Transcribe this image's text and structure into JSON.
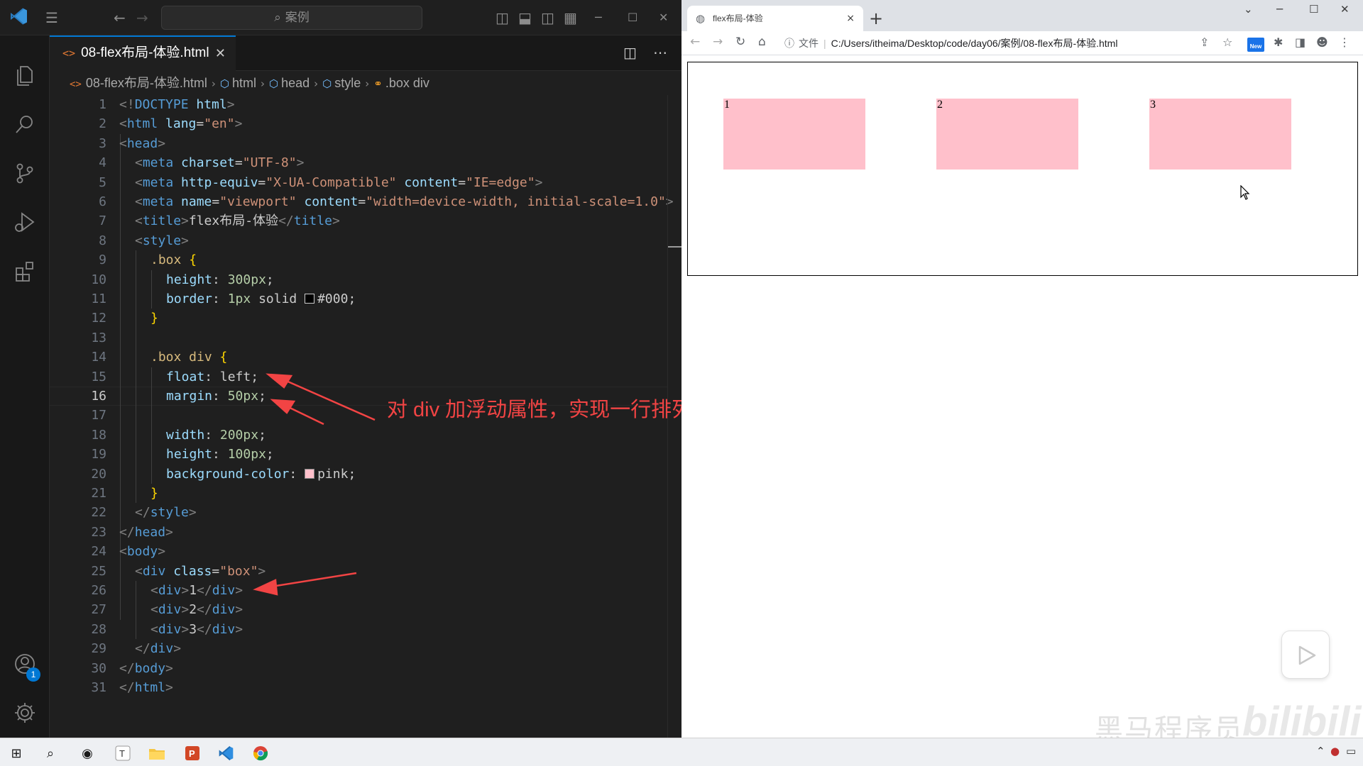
{
  "vscode": {
    "search_placeholder": "案例",
    "tab": {
      "label": "08-flex布局-体验.html",
      "close": "✕"
    },
    "breadcrumb": {
      "file": "08-flex布局-体验.html",
      "items": [
        "html",
        "head",
        "style",
        ".box div"
      ]
    },
    "account_badge": "1",
    "code": {
      "line_numbers": [
        "1",
        "2",
        "3",
        "4",
        "5",
        "6",
        "7",
        "8",
        "9",
        "10",
        "11",
        "12",
        "13",
        "14",
        "15",
        "16",
        "17",
        "18",
        "19",
        "20",
        "21",
        "22",
        "23",
        "24",
        "25",
        "26",
        "27",
        "28",
        "29",
        "30",
        "31"
      ],
      "current_line": "16",
      "l1": {
        "a": "<!",
        "b": "DOCTYPE",
        "c": " html",
        "d": ">"
      },
      "l2": {
        "a": "<",
        "b": "html",
        "c": " lang",
        "d": "=",
        "e": "\"en\"",
        "f": ">"
      },
      "l3": {
        "a": "<",
        "b": "head",
        "c": ">"
      },
      "l4": {
        "a": "<",
        "b": "meta",
        "c": " charset",
        "d": "=",
        "e": "\"UTF-8\"",
        "f": ">"
      },
      "l5": {
        "a": "<",
        "b": "meta",
        "c": " http-equiv",
        "d": "=",
        "e": "\"X-UA-Compatible\"",
        "f": " content",
        "g": "=",
        "h": "\"IE=edge\"",
        "i": ">"
      },
      "l6": {
        "a": "<",
        "b": "meta",
        "c": " name",
        "d": "=",
        "e": "\"viewport\"",
        "f": " content",
        "g": "=",
        "h": "\"width=device-width, initial-scale=1.0\"",
        "i": ">"
      },
      "l7": {
        "a": "<",
        "b": "title",
        "c": ">",
        "d": "flex布局-体验",
        "e": "</",
        "f": "title",
        "g": ">"
      },
      "l8": {
        "a": "<",
        "b": "style",
        "c": ">"
      },
      "l9": {
        "a": ".box",
        "b": " {"
      },
      "l10": {
        "a": "height",
        "b": ": ",
        "c": "300px",
        "d": ";"
      },
      "l11": {
        "a": "border",
        "b": ": ",
        "c": "1px",
        "d": " solid ",
        "e": "#000",
        "f": ";",
        "swatch": "#000000"
      },
      "l12": {
        "a": "}"
      },
      "l14": {
        "a": ".box div",
        "b": " {"
      },
      "l15": {
        "a": "float",
        "b": ": ",
        "c": "left",
        "d": ";"
      },
      "l16": {
        "a": "margin",
        "b": ": ",
        "c": "50px",
        "d": ";"
      },
      "l18": {
        "a": "width",
        "b": ": ",
        "c": "200px",
        "d": ";"
      },
      "l19": {
        "a": "height",
        "b": ": ",
        "c": "100px",
        "d": ";"
      },
      "l20": {
        "a": "background-color",
        "b": ": ",
        "c": "pink",
        "d": ";",
        "swatch": "#ffc0cb"
      },
      "l21": {
        "a": "}"
      },
      "l22": {
        "a": "</",
        "b": "style",
        "c": ">"
      },
      "l23": {
        "a": "</",
        "b": "head",
        "c": ">"
      },
      "l24": {
        "a": "<",
        "b": "body",
        "c": ">"
      },
      "l25": {
        "a": "<",
        "b": "div",
        "c": " class",
        "d": "=",
        "e": "\"box\"",
        "f": ">"
      },
      "l26": {
        "a": "<",
        "b": "div",
        "c": ">",
        "d": "1",
        "e": "</",
        "f": "div",
        "g": ">"
      },
      "l27": {
        "a": "<",
        "b": "div",
        "c": ">",
        "d": "2",
        "e": "</",
        "f": "div",
        "g": ">"
      },
      "l28": {
        "a": "<",
        "b": "div",
        "c": ">",
        "d": "3",
        "e": "</",
        "f": "div",
        "g": ">"
      },
      "l29": {
        "a": "</",
        "b": "div",
        "c": ">"
      },
      "l30": {
        "a": "</",
        "b": "body",
        "c": ">"
      },
      "l31": {
        "a": "</",
        "b": "html",
        "c": ">"
      }
    },
    "annotation": "对 div 加浮动属性，实现一行排列的效果。"
  },
  "browser": {
    "tab_title": "flex布局-体验",
    "tab_close": "×",
    "new_tab": "+",
    "omnibox": {
      "security_label": "文件",
      "url": "C:/Users/itheima/Desktop/code/day06/案例/08-flex布局-体验.html"
    },
    "extension_badge": "New",
    "page": {
      "items": [
        "1",
        "2",
        "3"
      ],
      "item_color": "#ffc0cb"
    }
  },
  "watermark": {
    "channel": "黑马程序员",
    "site": "bilibili"
  },
  "colors": {
    "accent": "#0078d4",
    "annotation": "#f24444",
    "tag": "#569cd6",
    "attribute": "#9cdcfe",
    "string": "#ce9178",
    "selector": "#d7ba7d",
    "number": "#b5cea8"
  }
}
